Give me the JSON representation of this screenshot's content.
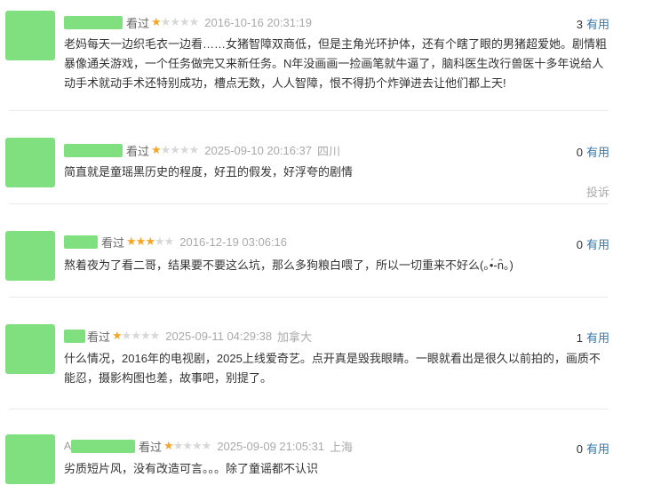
{
  "reviews": [
    {
      "prefix": "",
      "watched": "看过",
      "rating": 1,
      "time": "2016-10-16 20:31:19",
      "location": "",
      "votes": "3",
      "useful_label": "有用",
      "content": "老妈每天一边织毛衣一边看……女猪智障双商低，但是主角光环护体，还有个瞎了眼的男猪超爱她。剧情粗暴像通关游戏，一个任务做完又来新任务。N年没画画一捡画笔就牛逼了，脑科医生改行兽医十多年说给人动手术就动手术还特别成功，槽点无数，人人智障，恨不得扔个炸弹进去让他们都上天!"
    },
    {
      "prefix": "",
      "watched": "看过",
      "rating": 1,
      "time": "2025-09-10 20:16:37",
      "location": "四川",
      "votes": "0",
      "useful_label": "有用",
      "content": "简直就是童瑶黑历史的程度，好丑的假发，好浮夸的剧情",
      "report": "投诉"
    },
    {
      "prefix": "",
      "watched": "看过",
      "rating": 3,
      "time": "2016-12-19 03:06:16",
      "location": "",
      "votes": "0",
      "useful_label": "有用",
      "content": "熬着夜为了看二哥，结果要不要这么坑，那么多狗粮白喂了，所以一切重来不好么(｡•́-n̂｡)"
    },
    {
      "prefix": "",
      "watched": "看过",
      "rating": 1,
      "time": "2025-09-11 04:29:38",
      "location": "加拿大",
      "votes": "1",
      "useful_label": "有用",
      "content": "什么情况，2016年的电视剧，2025上线爱奇艺。点开真是毁我眼睛。一眼就看出是很久以前拍的，画质不能忍，摄影构图也差，故事吧，别提了。"
    },
    {
      "prefix": "A",
      "watched": "看过",
      "rating": 1,
      "time": "2025-09-09 21:05:31",
      "location": "上海",
      "votes": "0",
      "useful_label": "有用",
      "content": "劣质短片风，没有改造可言。。。除了童谣都不认识"
    }
  ],
  "colors": {
    "accent": "#3377aa",
    "star": "#f5a623",
    "placeholder": "#80e080"
  }
}
